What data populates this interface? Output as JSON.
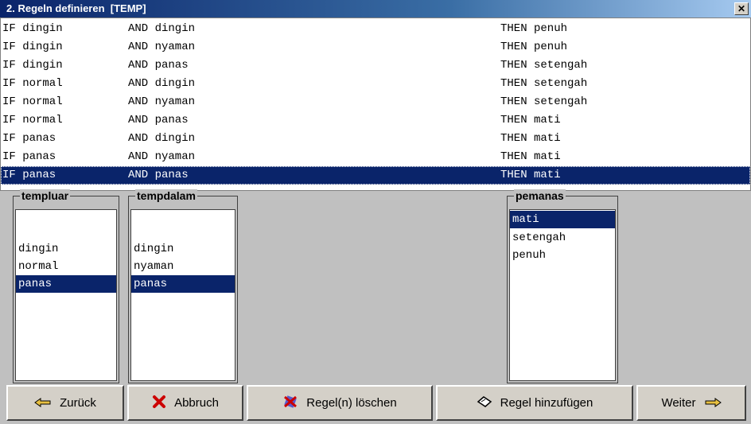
{
  "window": {
    "title": "2. Regeln definieren  [TEMP]",
    "close_glyph": "✕"
  },
  "rules": [
    {
      "if": "IF dingin",
      "and": "AND dingin",
      "then": "THEN penuh"
    },
    {
      "if": "IF dingin",
      "and": "AND nyaman",
      "then": "THEN penuh"
    },
    {
      "if": "IF dingin",
      "and": "AND panas",
      "then": "THEN setengah"
    },
    {
      "if": "IF normal",
      "and": "AND dingin",
      "then": "THEN setengah"
    },
    {
      "if": "IF normal",
      "and": "AND nyaman",
      "then": "THEN setengah"
    },
    {
      "if": "IF normal",
      "and": "AND panas",
      "then": "THEN mati"
    },
    {
      "if": "IF panas",
      "and": "AND dingin",
      "then": "THEN mati"
    },
    {
      "if": "IF panas",
      "and": "AND nyaman",
      "then": "THEN mati"
    },
    {
      "if": "IF panas",
      "and": "AND panas",
      "then": "THEN mati"
    }
  ],
  "groups": {
    "templuar": {
      "label": "templuar",
      "items": [
        "",
        "dingin",
        "normal",
        "panas"
      ]
    },
    "tempdalam": {
      "label": "tempdalam",
      "items": [
        "",
        "dingin",
        "nyaman",
        "panas"
      ]
    },
    "pemanas": {
      "label": "pemanas",
      "items": [
        "mati",
        "setengah",
        "penuh"
      ]
    }
  },
  "buttons": {
    "back": "Zurück",
    "cancel": "Abbruch",
    "delete": "Regel(n) löschen",
    "add": "Regel hinzufügen",
    "next": "Weiter"
  },
  "icons": {
    "back": "back-hand-icon",
    "cancel": "red-x-icon",
    "delete": "delete-rule-icon",
    "add": "add-rule-icon",
    "next": "next-hand-icon"
  },
  "colors": {
    "selection": "#0a246a",
    "cancel_icon": "#cc0000"
  }
}
